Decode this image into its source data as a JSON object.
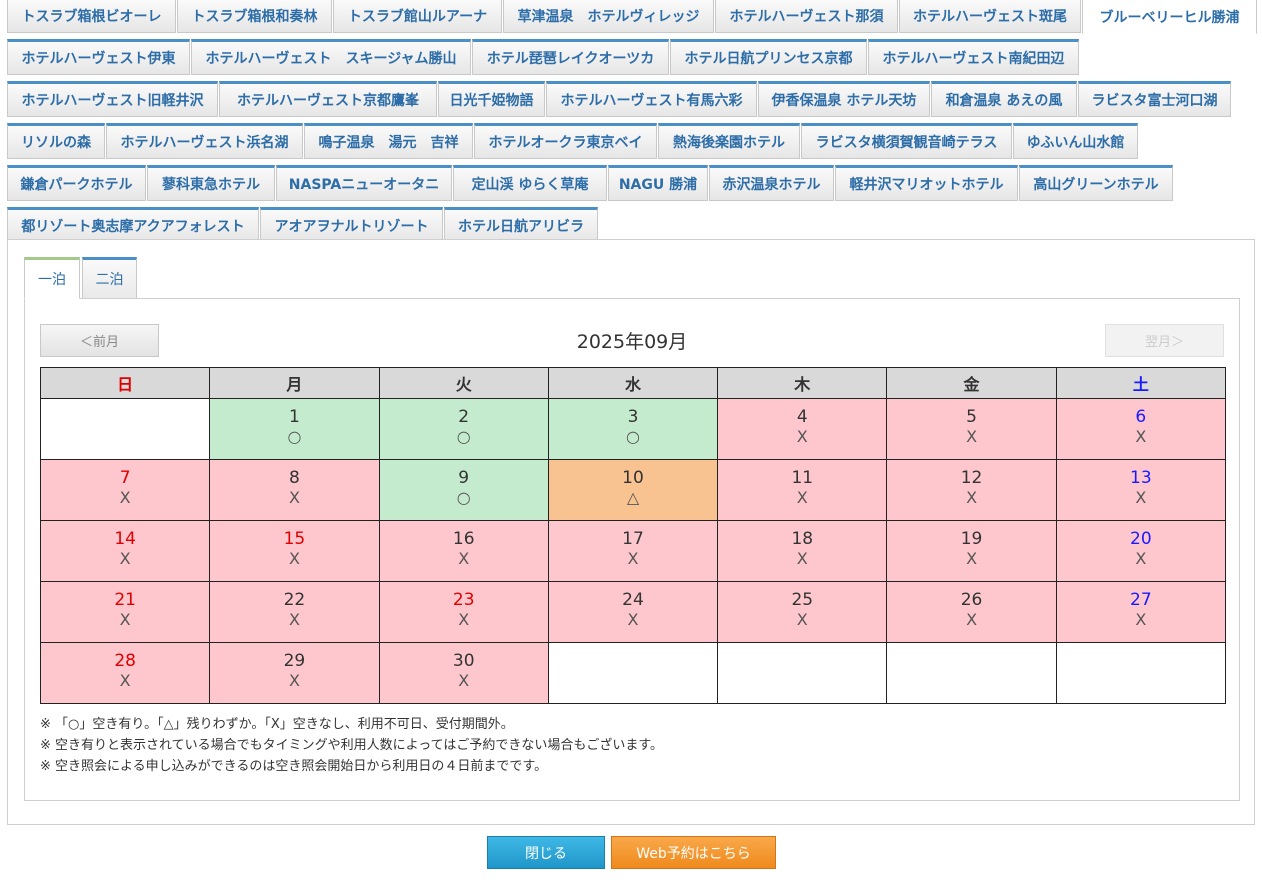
{
  "hotel_tabs": {
    "rows": [
      [
        "トスラブ箱根ビオーレ",
        "トスラブ箱根和奏林",
        "トスラブ館山ルアーナ",
        "草津温泉　ホテルヴィレッジ",
        "ホテルハーヴェスト那須",
        "ホテルハーヴェスト斑尾",
        "ブルーベリーヒル勝浦"
      ],
      [
        "ホテルハーヴェスト伊東",
        "ホテルハーヴェスト　スキージャム勝山",
        "ホテル琵琶レイクオーツカ",
        "ホテル日航プリンセス京都",
        "ホテルハーヴェスト南紀田辺"
      ],
      [
        "ホテルハーヴェスト旧軽井沢",
        "ホテルハーヴェスト京都鷹峯",
        "日光千姫物語",
        "ホテルハーヴェスト有馬六彩",
        "伊香保温泉 ホテル天坊",
        "和倉温泉 あえの風",
        "ラビスタ富士河口湖"
      ],
      [
        "リソルの森",
        "ホテルハーヴェスト浜名湖",
        "鳴子温泉　湯元　吉祥",
        "ホテルオークラ東京ベイ",
        "熱海後楽園ホテル",
        "ラビスタ横須賀観音崎テラス",
        "ゆふいん山水館"
      ],
      [
        "鎌倉パークホテル",
        "蓼科東急ホテル",
        "NASPAニューオータニ",
        "定山渓 ゆらく草庵",
        "NAGU 勝浦",
        "赤沢温泉ホテル",
        "軽井沢マリオットホテル",
        "高山グリーンホテル"
      ],
      [
        "都リゾート奥志摩アクアフォレスト",
        "アオアヲナルトリゾート",
        "ホテル日航アリビラ"
      ]
    ],
    "active": "ブルーベリーヒル勝浦"
  },
  "night_tabs": {
    "one": "一泊",
    "two": "二泊"
  },
  "calendar": {
    "prev_label": "＜前月",
    "next_label": "翌月＞",
    "month_title": "2025年09月",
    "weekdays": [
      "日",
      "月",
      "火",
      "水",
      "木",
      "金",
      "土"
    ],
    "weeks": [
      [
        null,
        {
          "day": "1",
          "status": "○"
        },
        {
          "day": "2",
          "status": "○"
        },
        {
          "day": "3",
          "status": "○"
        },
        {
          "day": "4",
          "status": "X"
        },
        {
          "day": "5",
          "status": "X"
        },
        {
          "day": "6",
          "status": "X"
        }
      ],
      [
        {
          "day": "7",
          "status": "X"
        },
        {
          "day": "8",
          "status": "X"
        },
        {
          "day": "9",
          "status": "○"
        },
        {
          "day": "10",
          "status": "△"
        },
        {
          "day": "11",
          "status": "X"
        },
        {
          "day": "12",
          "status": "X"
        },
        {
          "day": "13",
          "status": "X"
        }
      ],
      [
        {
          "day": "14",
          "status": "X"
        },
        {
          "day": "15",
          "status": "X",
          "holiday": true
        },
        {
          "day": "16",
          "status": "X"
        },
        {
          "day": "17",
          "status": "X"
        },
        {
          "day": "18",
          "status": "X"
        },
        {
          "day": "19",
          "status": "X"
        },
        {
          "day": "20",
          "status": "X"
        }
      ],
      [
        {
          "day": "21",
          "status": "X"
        },
        {
          "day": "22",
          "status": "X"
        },
        {
          "day": "23",
          "status": "X",
          "holiday": true
        },
        {
          "day": "24",
          "status": "X"
        },
        {
          "day": "25",
          "status": "X"
        },
        {
          "day": "26",
          "status": "X"
        },
        {
          "day": "27",
          "status": "X"
        }
      ],
      [
        {
          "day": "28",
          "status": "X"
        },
        {
          "day": "29",
          "status": "X"
        },
        {
          "day": "30",
          "status": "X"
        },
        null,
        null,
        null,
        null
      ]
    ]
  },
  "notes": [
    "※ 「○」空き有り。「△」残りわずか。「X」空きなし、利用不可日、受付期間外。",
    "※ 空き有りと表示されている場合でもタイミングや利用人数によってはご予約できない場合もございます。",
    "※ 空き照会による申し込みができるのは空き照会開始日から利用日の４日前までです。"
  ],
  "buttons": {
    "close": "閉じる",
    "web": "Web予約はこちら"
  },
  "colors": {
    "available": "#c5ebcf",
    "few": "#f8c291",
    "full": "#fdc7cd",
    "sunday": "#e00000",
    "saturday": "#1a1aff",
    "tab_accent": "#4b8fc8"
  }
}
